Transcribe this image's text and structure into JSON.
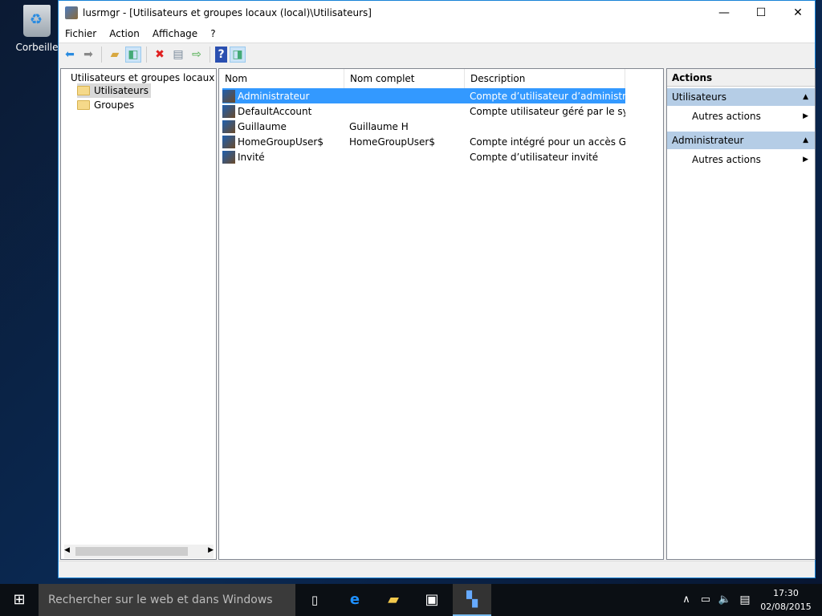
{
  "desktop": {
    "recycle_bin": "Corbeille"
  },
  "window": {
    "title": "lusrmgr - [Utilisateurs et groupes locaux (local)\\Utilisateurs]",
    "minimize": "—",
    "maximize": "☐",
    "close": "✕"
  },
  "menu": [
    "Fichier",
    "Action",
    "Affichage",
    "?"
  ],
  "toolbar": [
    "back-icon",
    "forward-icon",
    "up-folder-icon",
    "show-hide-console-tree-icon",
    "delete-icon",
    "properties-icon",
    "export-list-icon",
    "help-icon",
    "show-hide-action-pane-icon"
  ],
  "tree": {
    "root": "Utilisateurs et groupes locaux (lo",
    "items": [
      "Utilisateurs",
      "Groupes"
    ],
    "selected": "Utilisateurs"
  },
  "list": {
    "columns": [
      "Nom",
      "Nom complet",
      "Description"
    ],
    "rows": [
      {
        "name": "Administrateur",
        "full": "",
        "desc": "Compte d’utilisateur d’administra...",
        "selected": true
      },
      {
        "name": "DefaultAccount",
        "full": "",
        "desc": "Compte utilisateur géré par le syst..."
      },
      {
        "name": "Guillaume",
        "full": "Guillaume H",
        "desc": ""
      },
      {
        "name": "HomeGroupUser$",
        "full": "HomeGroupUser$",
        "desc": "Compte intégré pour un accès Gr..."
      },
      {
        "name": "Invité",
        "full": "",
        "desc": "Compte d’utilisateur invité"
      }
    ]
  },
  "actions": {
    "title": "Actions",
    "sections": [
      {
        "title": "Utilisateurs",
        "item": "Autres actions"
      },
      {
        "title": "Administrateur",
        "item": "Autres actions"
      }
    ]
  },
  "taskbar": {
    "search_placeholder": "Rechercher sur le web et dans Windows",
    "time": "17:30",
    "date": "02/08/2015"
  },
  "colors": {
    "selection": "#3399ff",
    "accent": "#1883d7",
    "action_section": "#b5cde6"
  }
}
